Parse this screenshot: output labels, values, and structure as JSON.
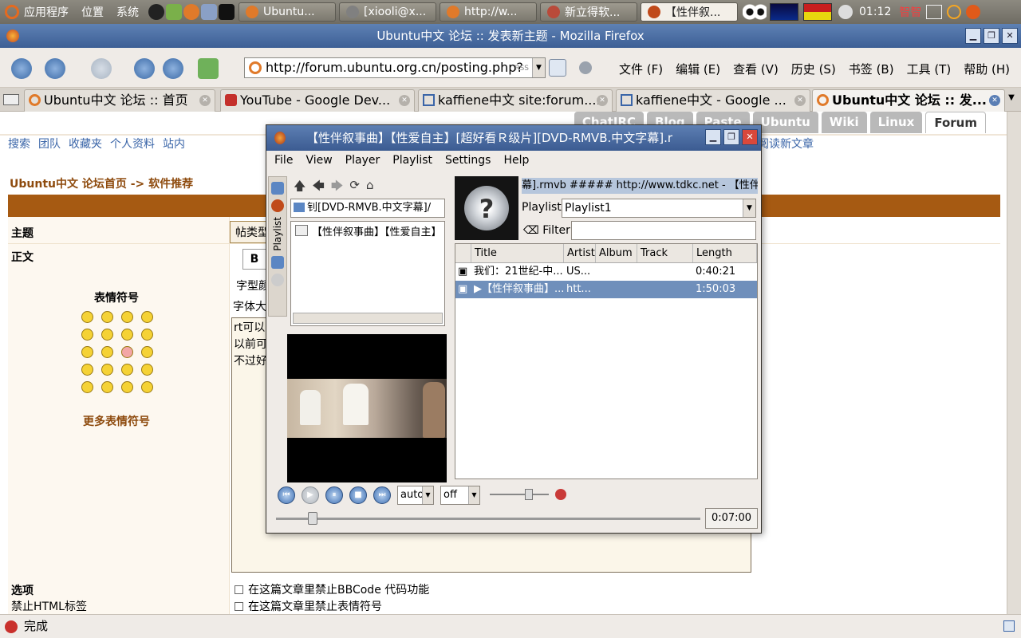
{
  "panel": {
    "menu_apps": "应用程序",
    "menu_places": "位置",
    "menu_system": "系统",
    "tasks": [
      {
        "label": "Ubuntu...",
        "color": "#e07a2a"
      },
      {
        "label": "[xiooli@x...",
        "color": "#808080"
      },
      {
        "label": "http://w...",
        "color": "#e07a2a"
      },
      {
        "label": "新立得软...",
        "color": "#b94a3a"
      },
      {
        "label": "【性伴叙...",
        "color": "#c04a1a",
        "active": true
      }
    ],
    "clock": "01:12",
    "ime_label": "智智"
  },
  "firefox": {
    "window_title": "Ubuntu中文 论坛 :: 发表新主题 - Mozilla Firefox",
    "url": "http://forum.ubuntu.org.cn/posting.php?",
    "rss_label": "RSS",
    "menu": [
      "文件 (F)",
      "编辑 (E)",
      "查看 (V)",
      "历史 (S)",
      "书签 (B)",
      "工具 (T)",
      "帮助 (H)"
    ],
    "tabs": [
      {
        "label": "Ubuntu中文 论坛 :: 首页",
        "fav_color": "#e07a2a"
      },
      {
        "label": "YouTube - Google Dev...",
        "fav_color": "#c4302b"
      },
      {
        "label": "kaffiene中文 site:forum....",
        "fav_color": "#3a65a8"
      },
      {
        "label": "kaffiene中文 - Google ...",
        "fav_color": "#3a65a8"
      },
      {
        "label": "Ubuntu中文 论坛 :: 发...",
        "fav_color": "#e07a2a",
        "active": true
      }
    ],
    "status": "完成"
  },
  "forum": {
    "top_tabs": [
      "ChatIRC",
      "Blog",
      "Paste",
      "Ubuntu",
      "Wiki",
      "Linux",
      "Forum"
    ],
    "nav_links": [
      "搜索",
      "团队",
      "收藏夹",
      "个人资料",
      "站内"
    ],
    "nav_right": "阅读新文章",
    "breadcrumb": "Ubuntu中文 论坛首页 -> 软件推荐",
    "label_subject": "主题",
    "label_body": "正文",
    "type_button": "帖类型",
    "bold_button": "B",
    "font_color_label": "字型颜",
    "font_size_label": "字体大",
    "body_lines": [
      "rt可以",
      "以前可",
      "不过好"
    ],
    "smilies_title": "表情符号",
    "more_smilies": "更多表情符号",
    "options_title": "选项",
    "options_html": "禁止HTML标签",
    "opt_bbcode": "在这篇文章里禁止BBCode 代码功能",
    "opt_smilies": "在这篇文章里禁止表情符号"
  },
  "player": {
    "title": "【性伴叙事曲】【性爱自主】[超好看Ｒ级片][DVD-RMVB.中文字幕].r",
    "menu": [
      "File",
      "View",
      "Player",
      "Playlist",
      "Settings",
      "Help"
    ],
    "side_tab_label": "Playlist",
    "path": "钊[DVD-RMVB.中文字幕]/",
    "file_item": "【性伴叙事曲】【性爱自主】",
    "track_info": "幕].rmvb  ##### http://www.tdkc.net - 【性伴叙事",
    "playlist_label": "Playlist:",
    "playlist_value": "Playlist1",
    "filter_label": "Filter:",
    "columns": [
      "Title",
      "Artist",
      "Album",
      "Track",
      "Length"
    ],
    "rows": [
      {
        "title": "我们：21世纪-中...",
        "artist": "US...",
        "length": "0:40:21",
        "selected": false
      },
      {
        "title": "▶【性伴叙事曲】...",
        "artist": "htt...",
        "length": "1:50:03",
        "selected": true
      }
    ],
    "aspect_value": "auto",
    "subtitle_value": "off",
    "time": "0:07:00"
  }
}
